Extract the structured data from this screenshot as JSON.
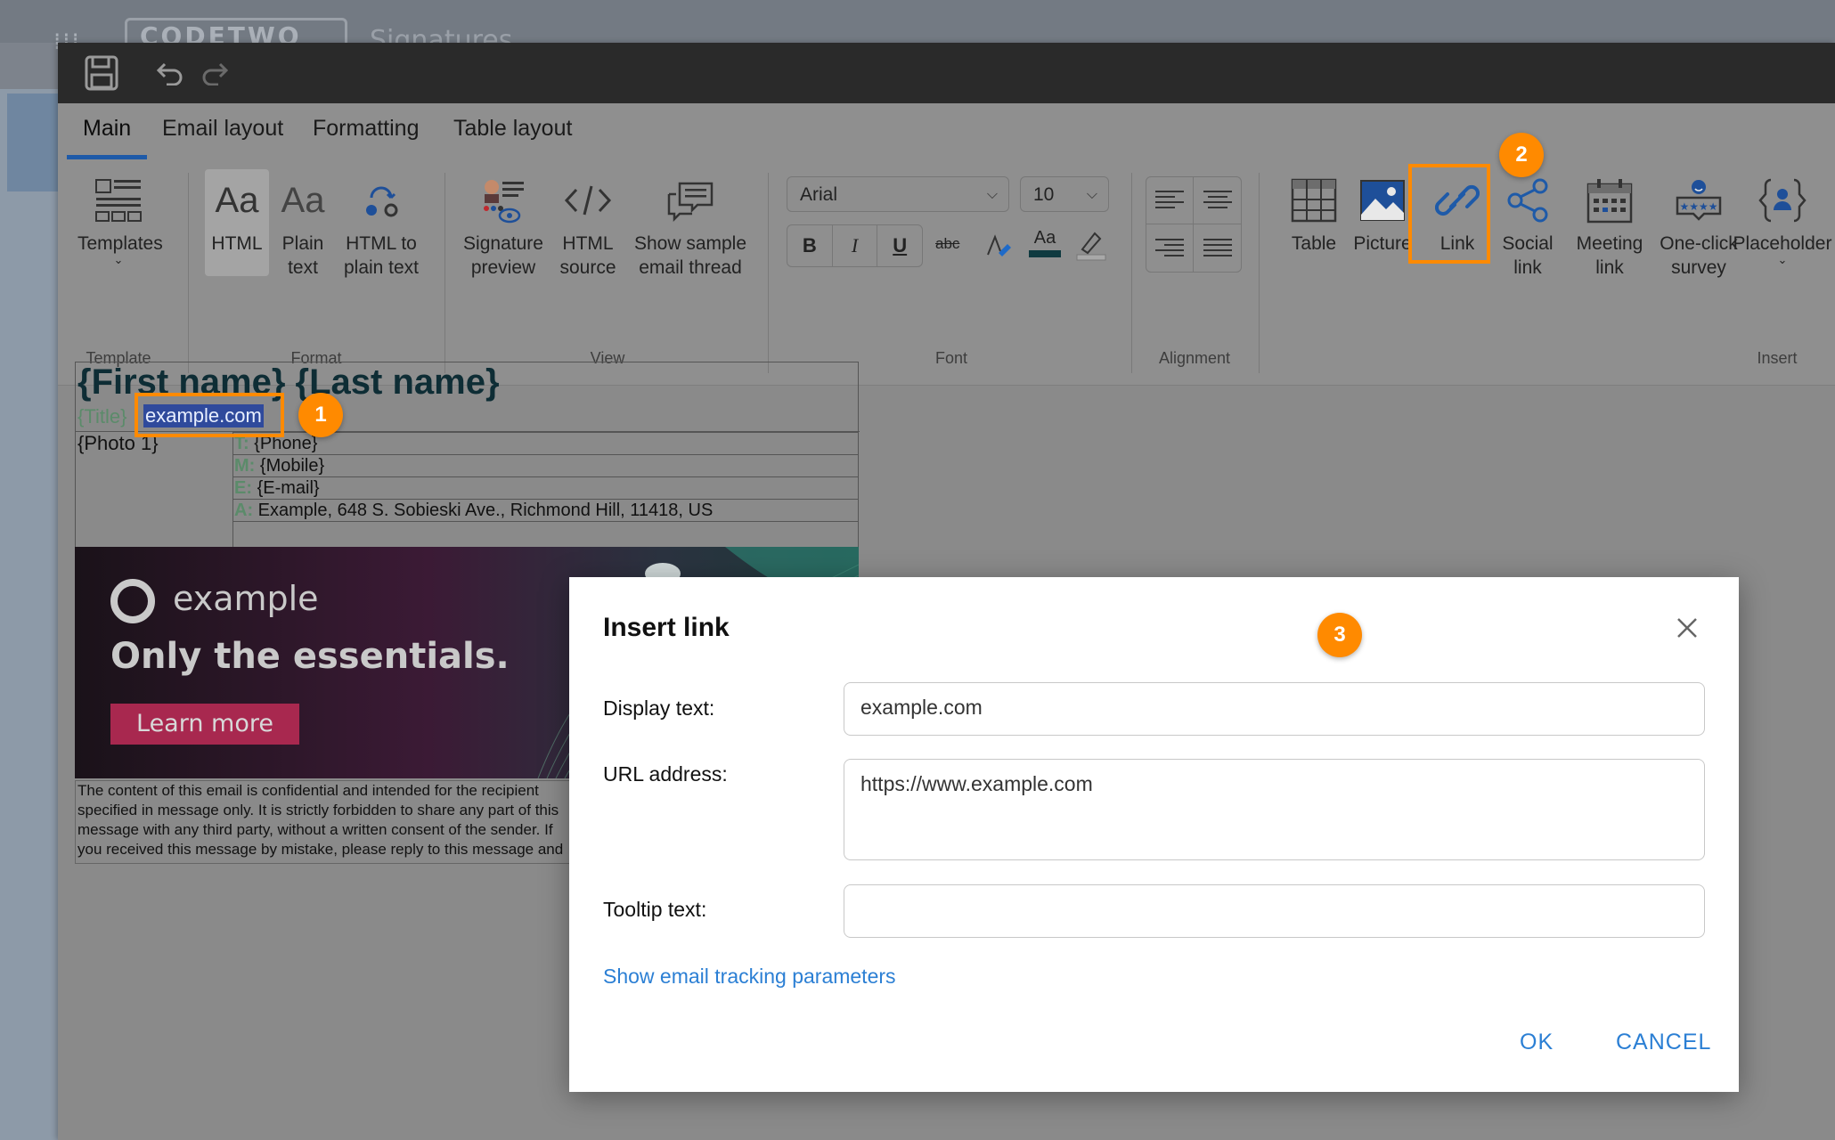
{
  "background": {
    "logo_text": "CODETWO",
    "title_text": "Signatures"
  },
  "tabs": [
    {
      "label": "Main",
      "active": true
    },
    {
      "label": "Email layout"
    },
    {
      "label": "Formatting"
    },
    {
      "label": "Table layout"
    }
  ],
  "ribbon": {
    "template": {
      "templates": "Templates",
      "group": "Template"
    },
    "format": {
      "html": "HTML",
      "plain_text": "Plain text",
      "html_to_plain": "HTML to plain text",
      "group": "Format"
    },
    "view": {
      "signature_preview": "Signature preview",
      "html_source": "HTML source",
      "show_sample": "Show sample email thread",
      "group": "View"
    },
    "font": {
      "family": "Arial",
      "size": "10",
      "group": "Font",
      "bold": "B",
      "italic": "I",
      "underline": "U",
      "strike": "abc",
      "font_color": "Aa"
    },
    "alignment": {
      "group": "Alignment"
    },
    "insert": {
      "table": "Table",
      "picture": "Picture",
      "link": "Link",
      "social_link": "Social link",
      "meeting_link": "Meeting link",
      "survey": "One-click survey",
      "placeholder": "Placeholder",
      "group": "Insert"
    }
  },
  "signature": {
    "name": "{First name} {Last name}",
    "title": "{Title}",
    "link_text": "example.com",
    "photo": "{Photo 1}",
    "lines": [
      {
        "prefix": "T:",
        "value": "{Phone}"
      },
      {
        "prefix": "M:",
        "value": "{Mobile}"
      },
      {
        "prefix": "E:",
        "value": "{E-mail}"
      },
      {
        "prefix": "A:",
        "value": "Example, 648 S. Sobieski Ave., Richmond Hill, 11418, US"
      }
    ]
  },
  "banner": {
    "logo_text": "example",
    "headline": "Only the essentials.",
    "button": "Learn more"
  },
  "disclaimer": "The content of this email is confidential and intended for the recipient specified in message only. It is strictly forbidden to share any part of this message with any third party, without a written consent of the sender. If you received this message by mistake, please reply to this message and follow with its deletion, so that we can ensure such a mistake does not occur in the future.",
  "callouts": [
    "1",
    "2",
    "3"
  ],
  "dialog": {
    "title": "Insert link",
    "display_text_label": "Display text:",
    "display_text_value": "example.com",
    "url_label": "URL address:",
    "url_value": "https://www.example.com",
    "tooltip_label": "Tooltip text:",
    "tooltip_value": "",
    "tracking_link": "Show email tracking parameters",
    "ok": "OK",
    "cancel": "CANCEL"
  },
  "colors": {
    "accent": "#ff8a00",
    "link": "#2b7fd4",
    "tab_underline": "#1e5aa8"
  }
}
